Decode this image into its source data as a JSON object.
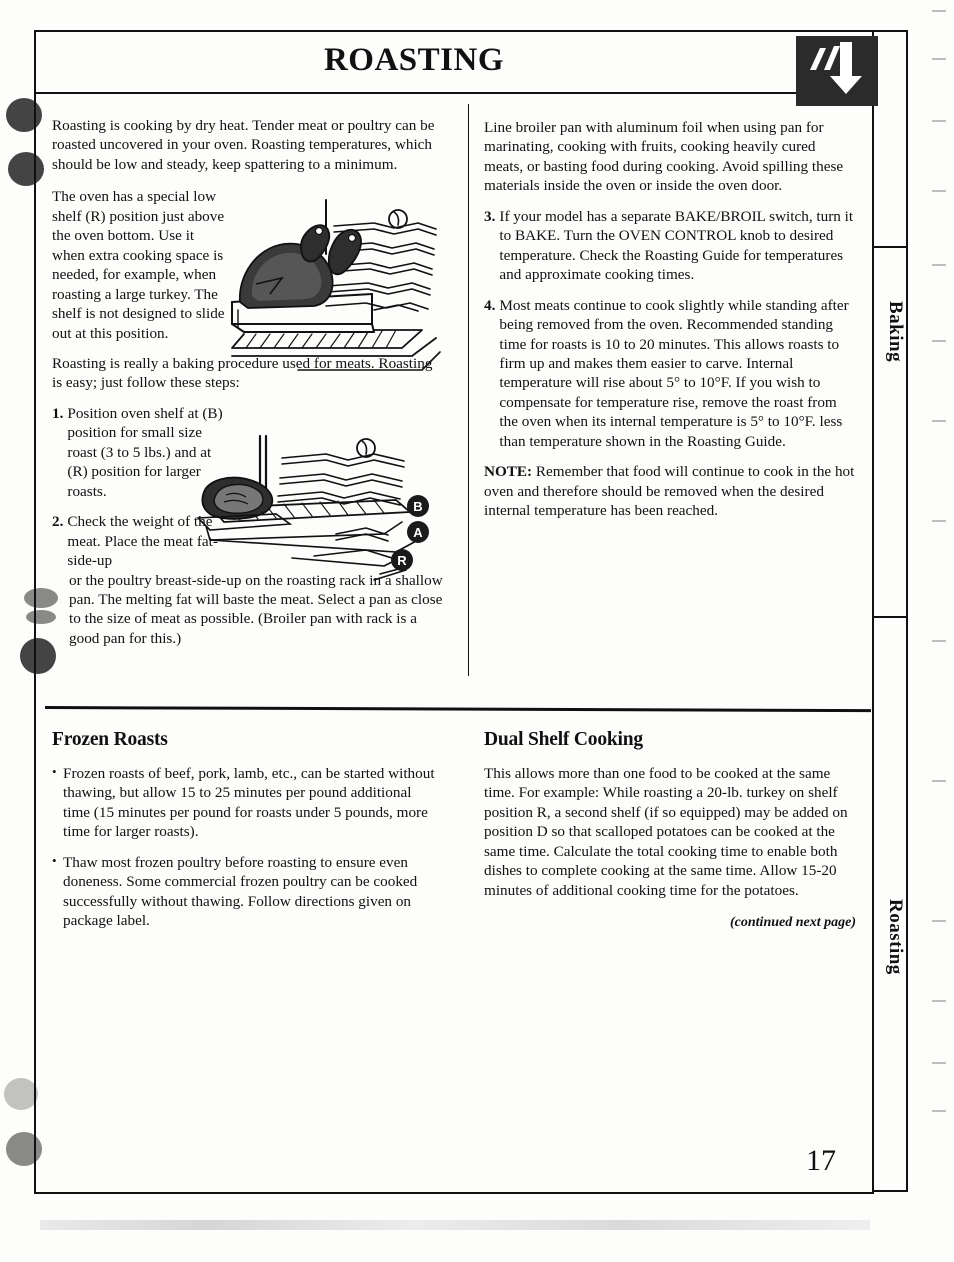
{
  "document": {
    "title": "ROASTING",
    "page_number": "17",
    "corner_icon": "down-arrow-icon"
  },
  "tabs": [
    {
      "label": "Baking"
    },
    {
      "label": "Roasting"
    }
  ],
  "left_column": {
    "intro": "Roasting is cooking by dry heat. Tender meat or poultry can be roasted uncovered in your oven. Roasting temperatures, which should be low and steady, keep spattering to a minimum.",
    "shelf_paragraph": "The oven has a special low shelf (R) position just above the oven bottom. Use it when extra cooking space is needed, for example, when roasting a large turkey. The shelf is not designed to slide out at this position.",
    "procedure_intro": "Roasting is really a baking procedure used for meats. Roasting is easy; just follow these steps:",
    "steps": [
      {
        "num": "1.",
        "text": "Position oven shelf at (B) position for small size roast (3 to 5 lbs.) and at (R) position for larger roasts."
      },
      {
        "num": "2.",
        "text_narrow": "Check the weight of the meat. Place the meat fat-side-up",
        "text_full": "or the poultry breast-side-up on the roasting rack in a shallow pan. The melting fat will baste the meat. Select a pan as close to the size of meat as possible. (Broiler pan with rack is a good pan for this.)"
      }
    ],
    "illustration_1": "turkey-in-roasting-pan-on-oven-shelf-illustration",
    "illustration_2": "oven-shelf-positions-b-a-r-illustration",
    "illustration_2_labels": [
      "B",
      "A",
      "R"
    ]
  },
  "right_column": {
    "foil_paragraph": "Line broiler pan with aluminum foil when using pan for marinating, cooking with fruits, cooking heavily cured meats, or basting food during cooking. Avoid spilling these materials inside the oven or inside the oven door.",
    "steps": [
      {
        "num": "3.",
        "text": "If your model has a separate BAKE/BROIL switch, turn it to BAKE. Turn the OVEN CONTROL knob to desired temperature. Check the Roasting Guide for temperatures and approximate cooking times."
      },
      {
        "num": "4.",
        "text": "Most meats continue to cook slightly while standing after being removed from the oven. Recommended standing time for roasts is 10 to 20 minutes. This allows roasts to firm up and makes them easier to carve. Internal temperature will rise about 5° to 10°F. If you wish to compensate for temperature rise, remove the roast from the oven when its internal temperature is 5° to 10°F. less than temperature shown in the Roasting Guide."
      }
    ],
    "note_label": "NOTE:",
    "note_text": " Remember that food will continue to cook in the hot oven and therefore should be removed when the desired internal temperature has been reached."
  },
  "bottom_left": {
    "heading": "Frozen Roasts",
    "bullets": [
      "Frozen roasts of beef, pork, lamb, etc., can be started without thawing, but allow 15 to 25 minutes per pound additional time (15 minutes per pound for roasts under 5 pounds, more time for larger roasts).",
      "Thaw most frozen poultry before roasting to ensure even doneness. Some commercial frozen poultry can be cooked successfully without thawing. Follow directions given on package label."
    ],
    "bullet_glyph": "•"
  },
  "bottom_right": {
    "heading": "Dual Shelf Cooking",
    "body": "This allows more than one food to be cooked at the same time. For example: While roasting a 20-lb. turkey on shelf position R, a second shelf (if so equipped) may be added on position D so that scalloped potatoes can be cooked at the same time. Calculate the total cooking time to enable both dishes to complete cooking at the same time. Allow 15-20 minutes of additional cooking time for the potatoes.",
    "continued": "(continued next page)"
  },
  "colors": {
    "ink": "#111111",
    "paper": "#fdfdfb",
    "icon_bg": "#2b2b2b"
  }
}
